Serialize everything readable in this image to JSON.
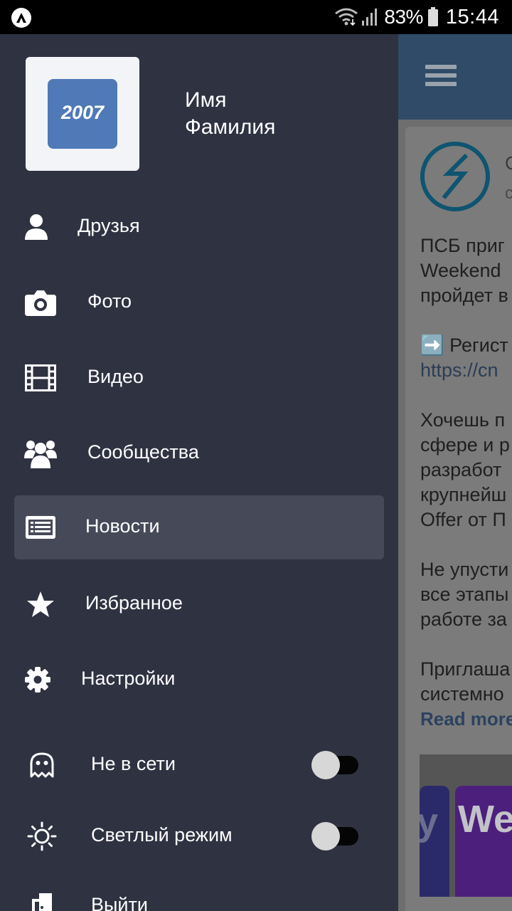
{
  "status_bar": {
    "battery": "83%",
    "time": "15:44"
  },
  "profile": {
    "avatar_text": "2007",
    "first_name": "Имя",
    "last_name": "Фамилия"
  },
  "menu": {
    "friends": "Друзья",
    "photo": "Фото",
    "video": "Видео",
    "communities": "Сообщества",
    "news": "Новости",
    "favorites": "Избранное",
    "settings": "Настройки",
    "offline": "Не в сети",
    "light_mode": "Светлый режим",
    "logout": "Выйти"
  },
  "toggles": {
    "offline_on": false,
    "light_mode_on": false
  },
  "post": {
    "author": "С",
    "subtitle": "с",
    "lines": [
      "ПСБ приг",
      "Weekend",
      "пройдет в",
      "➡️ Регист",
      "https://cn",
      "Хочешь п",
      "сфере и р",
      "разработ",
      "крупнейш",
      "Offer от П",
      "Не упусти",
      "все этапы",
      "работе за",
      "Приглаша",
      "системно"
    ],
    "read_more": "Read more",
    "promo_left": "y",
    "promo_right": "We"
  },
  "colors": {
    "drawer_bg": "#2f3241",
    "active_item": "#464a58",
    "avatar_bg": "#4f7ab7",
    "appbar": "#2f4b67"
  }
}
